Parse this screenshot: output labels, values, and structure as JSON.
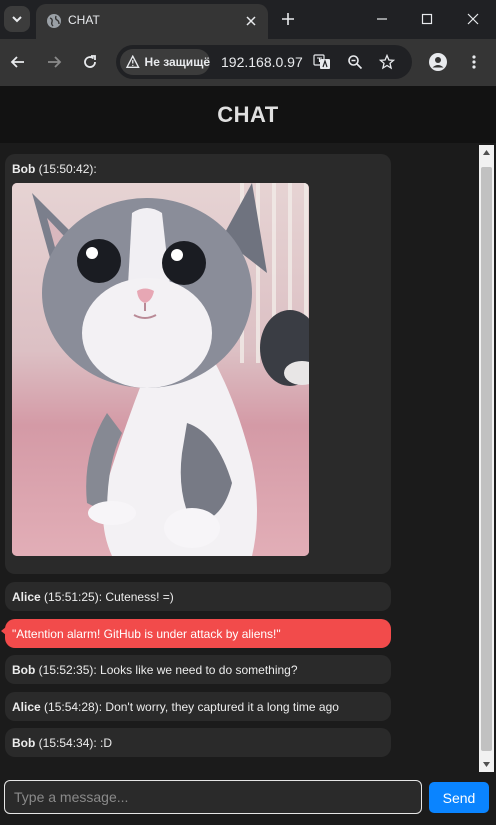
{
  "browser": {
    "tab_title": "CHAT",
    "security_label": "Не защищё",
    "url": "192.168.0.97"
  },
  "colors": {
    "accent": "#0a84ff",
    "alert_background": "#f24b4b"
  },
  "page": {
    "title": "CHAT"
  },
  "messages": [
    {
      "author": "Bob",
      "meta": " (15:50:42):",
      "text": "",
      "has_image": true,
      "image": "kitten-photo"
    },
    {
      "author": "Alice",
      "meta": " (15:51:25): ",
      "text": "Cuteness! =)"
    },
    {
      "author": "",
      "meta": "",
      "text": "\"Attention alarm! GitHub is under attack by aliens!\"",
      "alert": true
    },
    {
      "author": "Bob",
      "meta": " (15:52:35): ",
      "text": "Looks like we need to do something?"
    },
    {
      "author": "Alice",
      "meta": " (15:54:28): ",
      "text": "Don't worry, they captured it a long time ago"
    },
    {
      "author": "Bob",
      "meta": " (15:54:34): ",
      "text": ":D"
    }
  ],
  "composer": {
    "placeholder": "Type a message...",
    "value": "",
    "send_label": "Send"
  }
}
